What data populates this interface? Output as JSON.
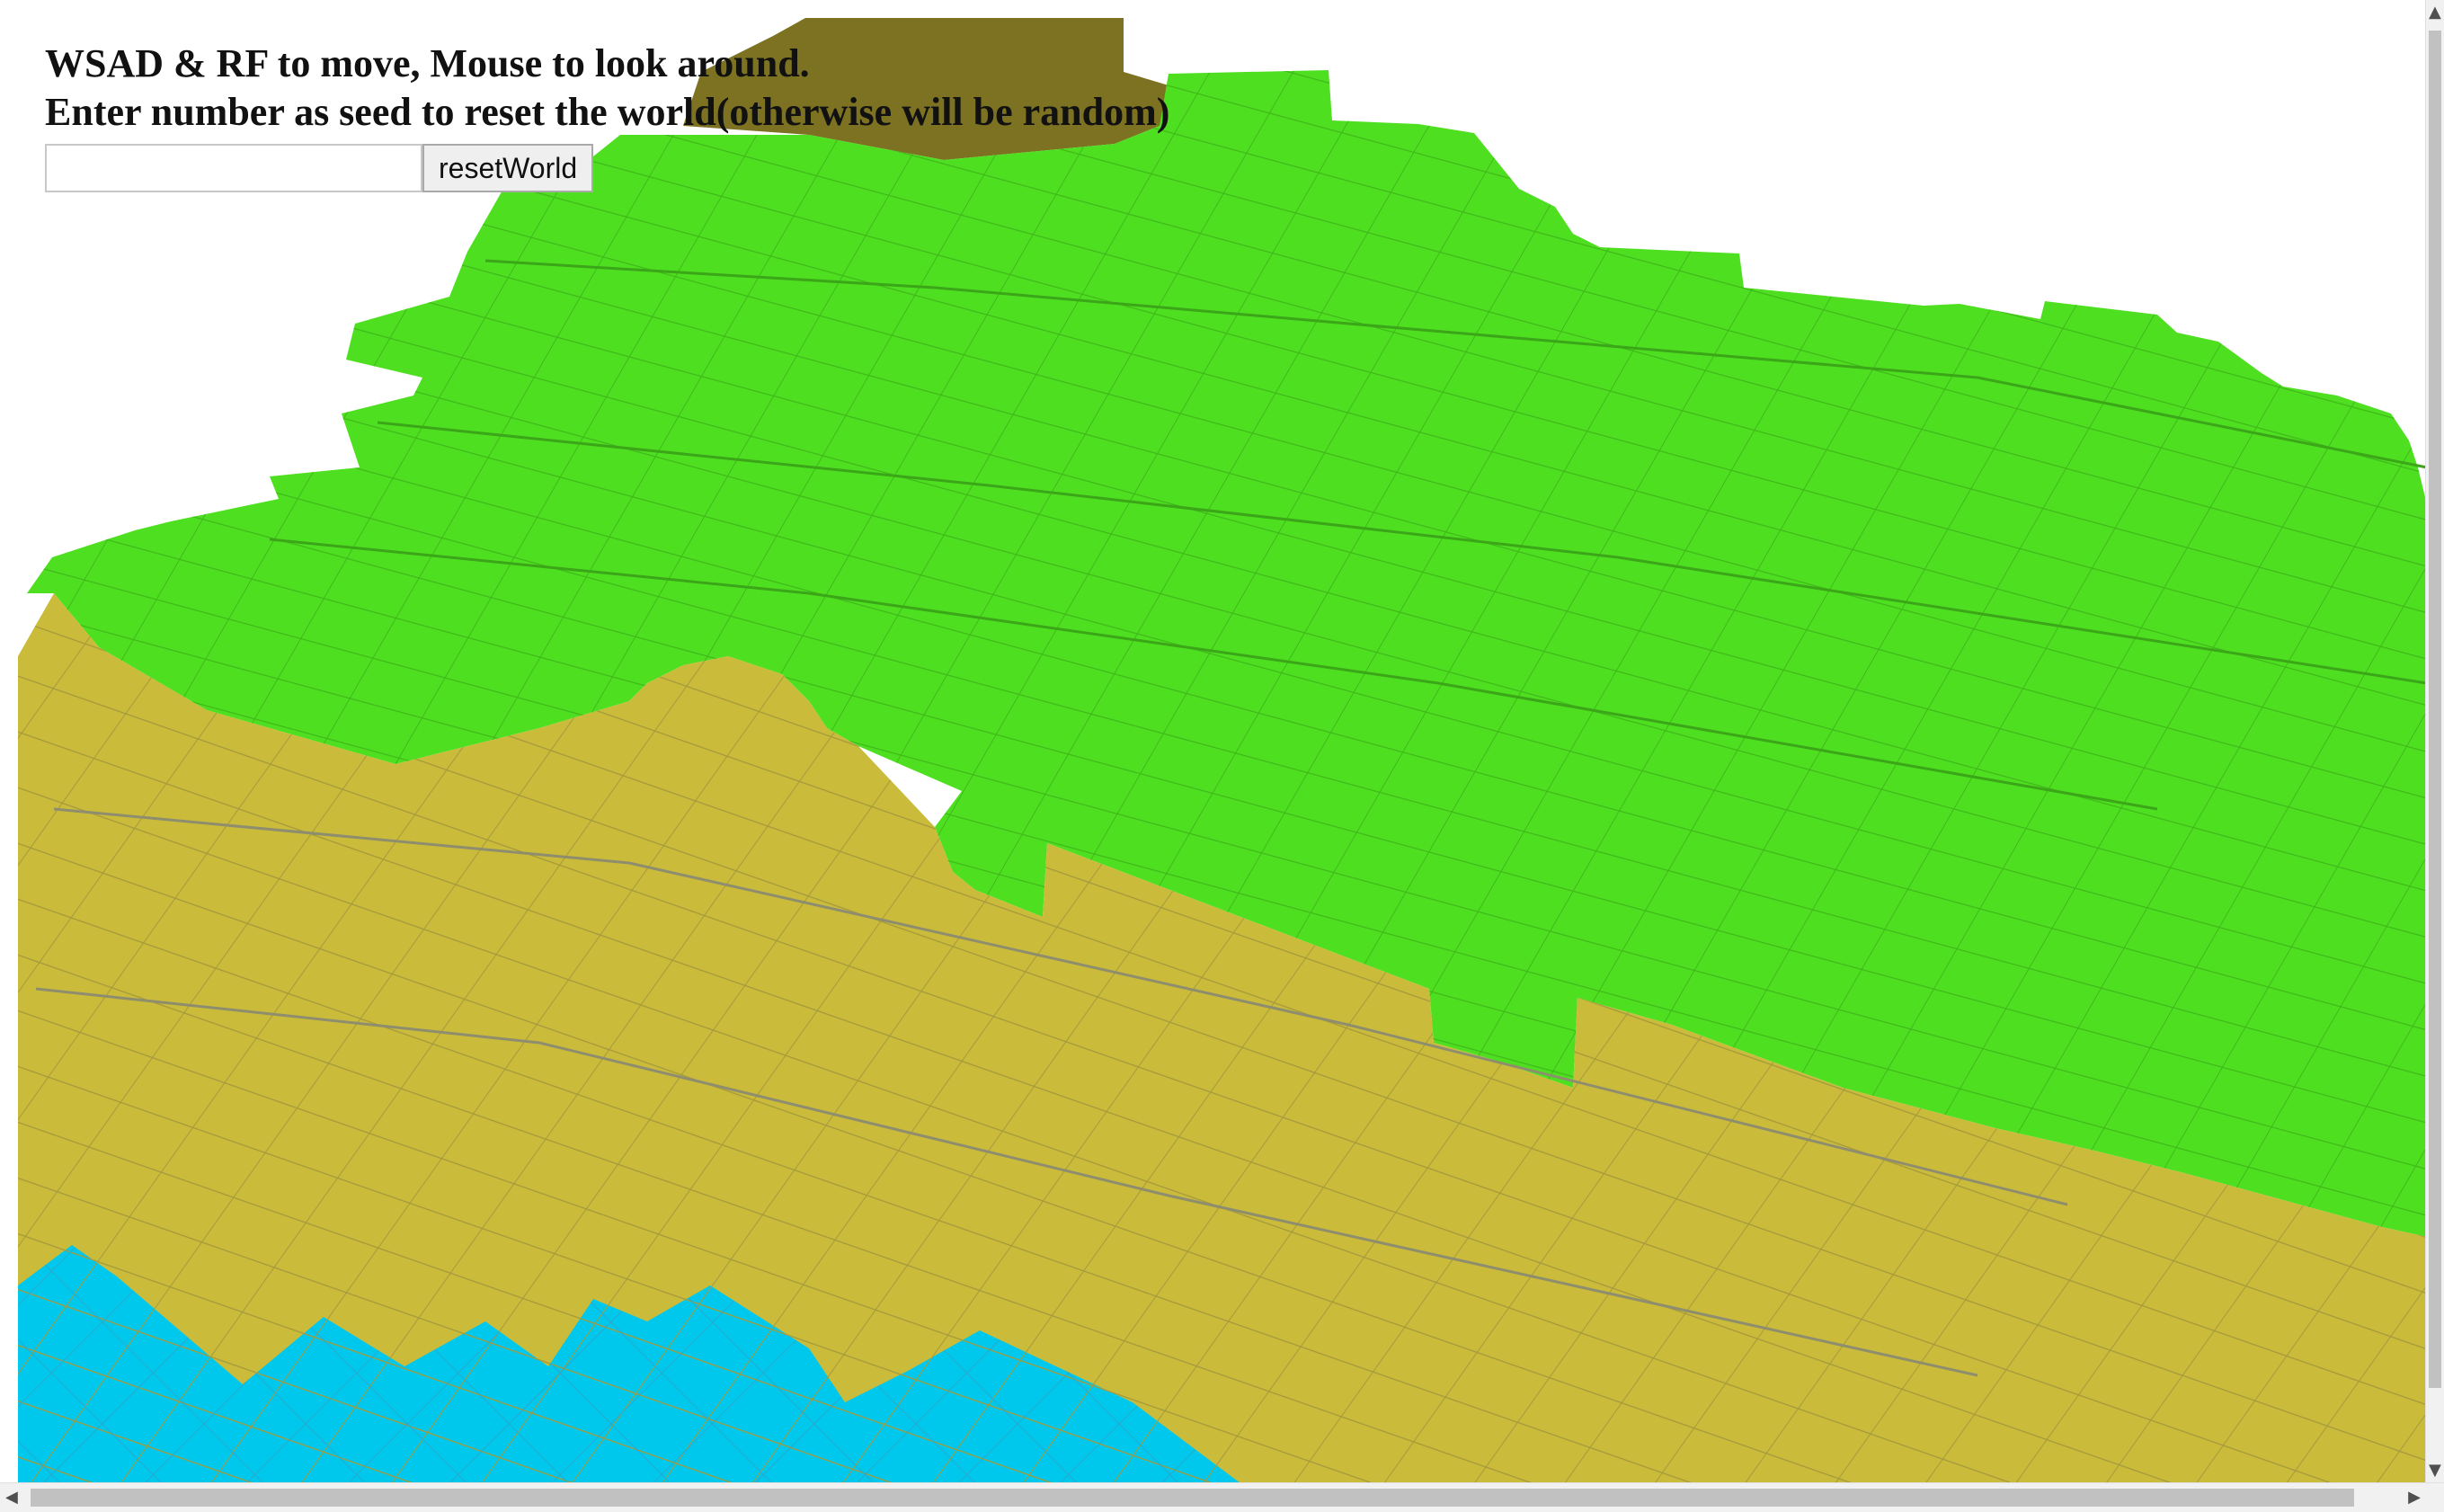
{
  "instructions": {
    "line1": "WSAD & RF to move, Mouse to look around.",
    "line2": "Enter number as seed to reset the world(otherwise will be random)"
  },
  "seed_input": {
    "value": "",
    "placeholder": ""
  },
  "reset_button": {
    "label": "resetWorld"
  },
  "terrain": {
    "colors": {
      "grass": "#4fdf21",
      "sand": "#cbbb3b",
      "water": "#00c8ec",
      "dirt": "#7c7222",
      "grid_line": "#8e8e6e"
    }
  },
  "scrollbars": {
    "vertical": {
      "up_icon": "▲",
      "down_icon": "▼"
    },
    "horizontal": {
      "left_icon": "◀",
      "right_icon": "▶"
    }
  }
}
